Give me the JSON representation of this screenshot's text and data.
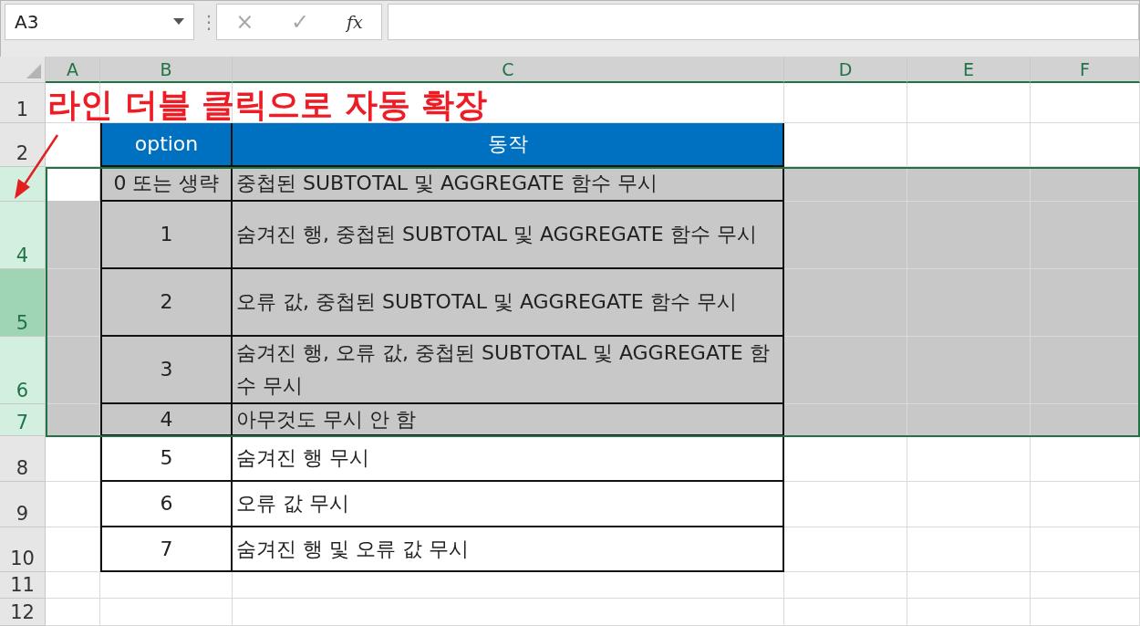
{
  "formula_bar": {
    "name_box": "A3",
    "more": "⋮",
    "cancel": "×",
    "enter": "✓",
    "function": "fx"
  },
  "columns": [
    {
      "label": "A",
      "selected": true
    },
    {
      "label": "B",
      "selected": true
    },
    {
      "label": "C",
      "selected": true
    },
    {
      "label": "D",
      "selected": true
    },
    {
      "label": "E",
      "selected": true
    },
    {
      "label": "F",
      "selected": true
    }
  ],
  "rows": [
    {
      "header": "1",
      "kind": "title",
      "selected": false,
      "text": "라인 더블 클릭으로 자동 확장"
    },
    {
      "header": "2",
      "kind": "table_header",
      "selected": false,
      "option": "option",
      "action": "동작"
    },
    {
      "kind": "data",
      "selected": true,
      "active": true,
      "option": "0 또는 생략",
      "action": "중첩된 SUBTOTAL 및 AGGREGATE 함수 무시"
    },
    {
      "header": "4",
      "kind": "data",
      "selected": true,
      "option": "1",
      "action": "숨겨진 행, 중첩된 SUBTOTAL 및 AGGREGATE 함수 무시"
    },
    {
      "header": "5",
      "kind": "data",
      "selected": true,
      "hovered": true,
      "option": "2",
      "action": "오류 값, 중첩된 SUBTOTAL 및 AGGREGATE 함수 무시"
    },
    {
      "header": "6",
      "kind": "data",
      "selected": true,
      "option": "3",
      "action": "숨겨진 행, 오류 값, 중첩된 SUBTOTAL 및 AGGREGATE 함수 무시"
    },
    {
      "header": "7",
      "kind": "data",
      "selected": true,
      "option": "4",
      "action": "아무것도 무시 안 함"
    },
    {
      "header": "8",
      "kind": "data",
      "selected": false,
      "option": "5",
      "action": "숨겨진 행 무시"
    },
    {
      "header": "9",
      "kind": "data",
      "selected": false,
      "option": "6",
      "action": "오류 값 무시"
    },
    {
      "header": "10",
      "kind": "data",
      "selected": false,
      "option": "7",
      "action": "숨겨진 행 및 오류 값 무시"
    },
    {
      "header": "11",
      "kind": "empty",
      "selected": false
    },
    {
      "header": "12",
      "kind": "empty",
      "selected": false
    }
  ]
}
